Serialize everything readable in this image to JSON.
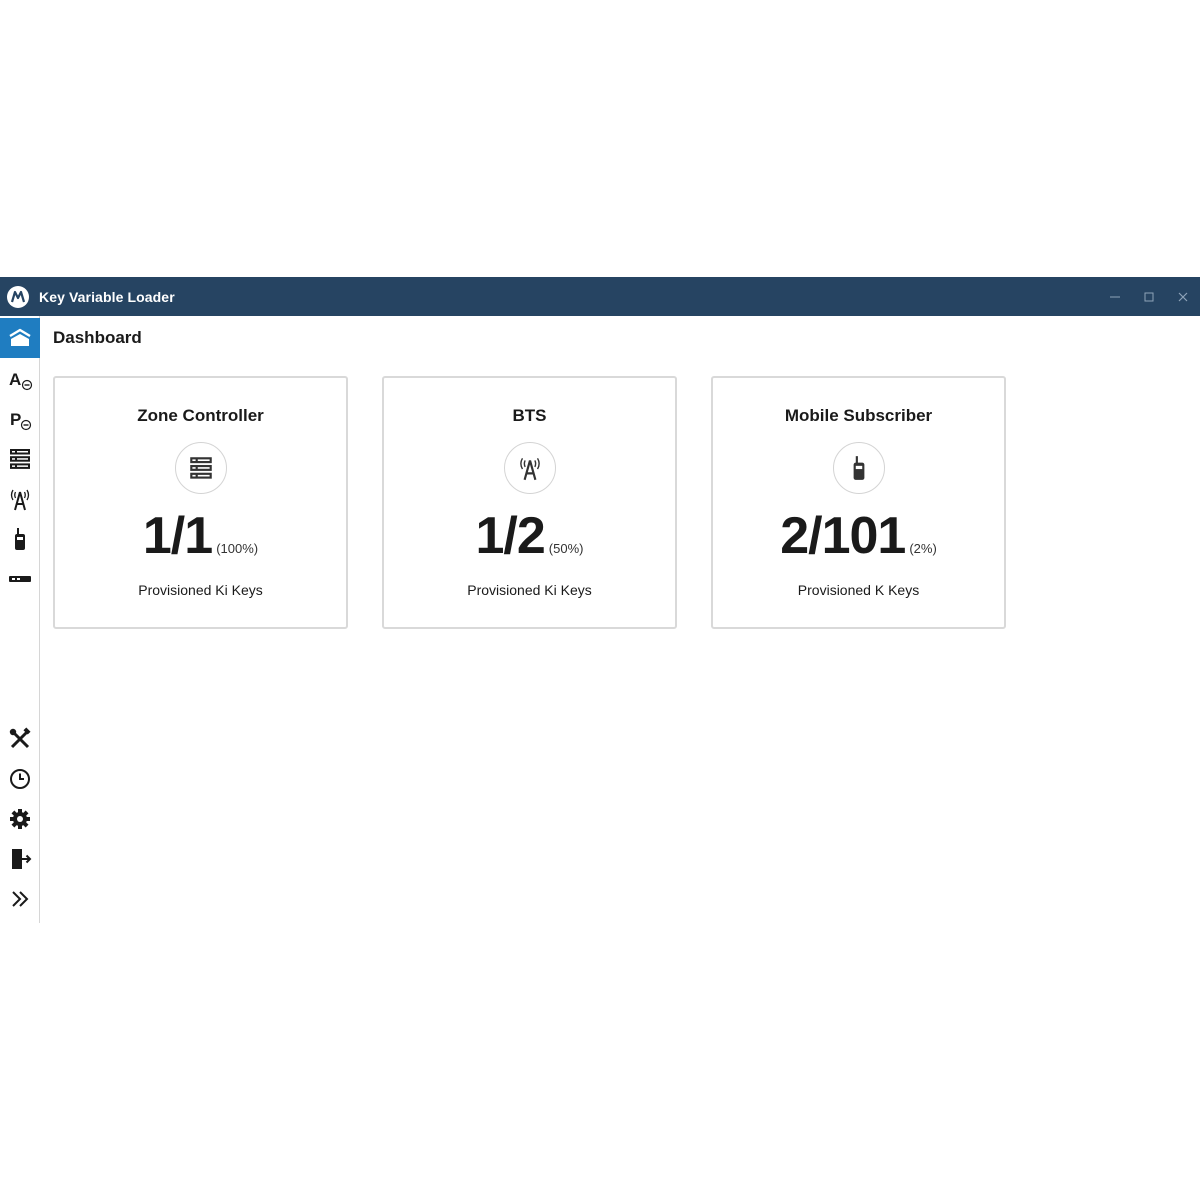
{
  "window": {
    "title": "Key Variable Loader"
  },
  "sidebar": {
    "items": [
      {
        "icon": "home-icon",
        "active": true
      },
      {
        "icon": "algorithm-key-icon",
        "glyph": "A"
      },
      {
        "icon": "profile-key-icon",
        "glyph": "P"
      },
      {
        "icon": "server-icon"
      },
      {
        "icon": "tower-icon"
      },
      {
        "icon": "radio-icon"
      },
      {
        "icon": "device-icon"
      },
      {
        "icon": "tools-icon"
      },
      {
        "icon": "clock-icon"
      },
      {
        "icon": "gear-icon"
      },
      {
        "icon": "logout-icon"
      },
      {
        "icon": "expand-icon"
      }
    ]
  },
  "main": {
    "title": "Dashboard",
    "cards": [
      {
        "title": "Zone Controller",
        "icon": "server-icon",
        "value": "1/1",
        "percent": "(100%)",
        "fraction": 1.0,
        "caption": "Provisioned Ki Keys"
      },
      {
        "title": "BTS",
        "icon": "tower-icon",
        "value": "1/2",
        "percent": "(50%)",
        "fraction": 0.5,
        "caption": "Provisioned Ki Keys"
      },
      {
        "title": "Mobile Subscriber",
        "icon": "radio-icon",
        "value": "2/101",
        "percent": "(2%)",
        "fraction": 0.0198,
        "caption": "Provisioned K Keys"
      }
    ]
  },
  "colors": {
    "titlebar": "#264462",
    "active_nav": "#1f7dc1",
    "card_border": "#d9d9d9"
  }
}
